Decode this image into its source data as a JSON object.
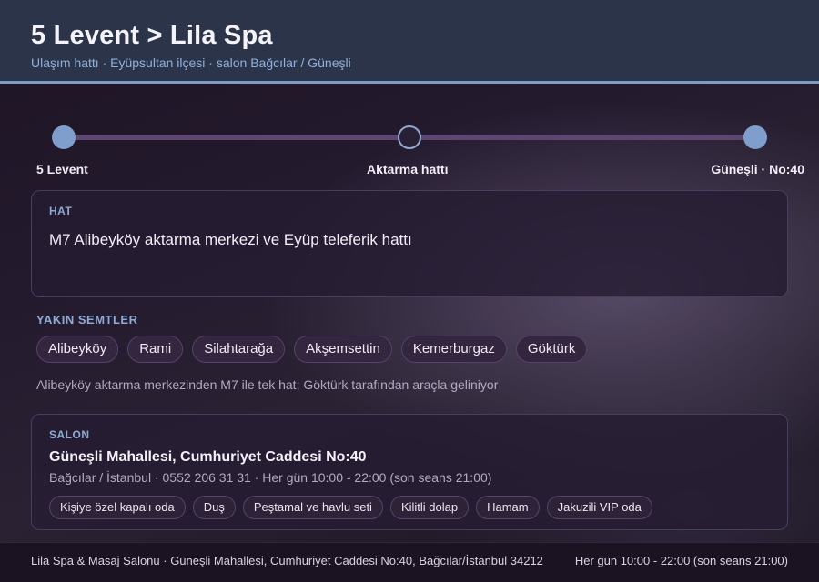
{
  "header": {
    "title": "5 Levent > Lila Spa",
    "subtitle": "Ulaşım hattı · Eyüpsultan ilçesi · salon Bağcılar / Güneşli"
  },
  "route": {
    "stops": [
      "5 Levent",
      "Aktarma hattı",
      "Güneşli · No:40"
    ]
  },
  "line_card": {
    "label": "HAT",
    "text": "M7 Alibeyköy aktarma merkezi ve Eyüp teleferik hattı"
  },
  "nearby": {
    "label": "YAKIN SEMTLER",
    "items": [
      "Alibeyköy",
      "Rami",
      "Silahtarağa",
      "Akşemsettin",
      "Kemerburgaz",
      "Göktürk"
    ],
    "note": "Alibeyköy aktarma merkezinden M7 ile tek hat; Göktürk tarafından araçla geliniyor"
  },
  "salon": {
    "label": "SALON",
    "address": "Güneşli Mahallesi, Cumhuriyet Caddesi No:40",
    "details": "Bağcılar / İstanbul · 0552 206 31 31 · Her gün 10:00 - 22:00 (son seans 21:00)",
    "features": [
      "Kişiye özel kapalı oda",
      "Duş",
      "Peştamal ve havlu seti",
      "Kilitli dolap",
      "Hamam",
      "Jakuzili VIP oda"
    ]
  },
  "footer": {
    "left": "Lila Spa & Masaj Salonu · Güneşli Mahallesi, Cumhuriyet Caddesi No:40, Bağcılar/İstanbul 34212",
    "right": "Her gün 10:00 - 22:00 (son seans 21:00)"
  },
  "colors": {
    "header_bg": "#2b3449",
    "accent": "#7f9cc8",
    "track": "#5b4770",
    "card_bg": "#261c32"
  }
}
